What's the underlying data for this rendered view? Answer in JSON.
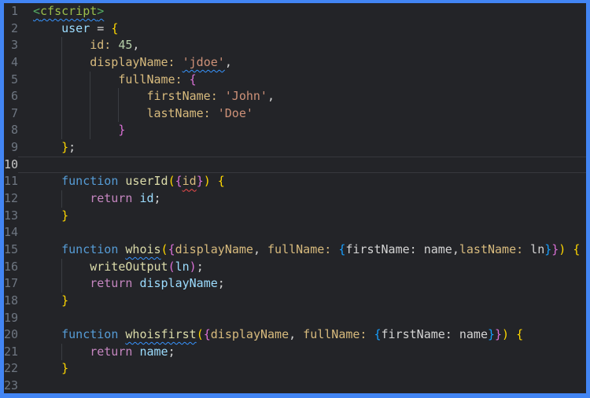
{
  "ui": {
    "frame_color": "#4285f4",
    "editor_background": "#232428",
    "gutter_color": "#6e7681",
    "active_gutter_color": "#c6c6c6",
    "indent_guide_color": "#3a3d42",
    "current_line_border_color": "#37383d"
  },
  "colors": {
    "tag": "#9cbe4a",
    "tagp": "#55ad63",
    "kw": "#569cd6",
    "ctrl": "#c586c0",
    "var": "#9cdcfe",
    "prop": "#d7ba7d",
    "str": "#ce9178",
    "num": "#b5cea8",
    "fn": "#dcdcaa",
    "pun": "#d4d4d4",
    "b1": "#ffd700",
    "b2": "#da70d6",
    "b3": "#179fff",
    "squiggle_info": "#3794ff",
    "squiggle_error": "#f14c4c"
  },
  "editor": {
    "current_line": "10",
    "lines": [
      {
        "num": "1",
        "indent": 0,
        "tokens": [
          {
            "t": "<",
            "c": "tagp",
            "u": "b"
          },
          {
            "t": "cfscript",
            "c": "tag",
            "u": "b"
          },
          {
            "t": ">",
            "c": "tagp",
            "u": "b"
          }
        ]
      },
      {
        "num": "2",
        "indent": 4,
        "tokens": [
          {
            "t": "user",
            "c": "var"
          },
          {
            "t": " = ",
            "c": "pun"
          },
          {
            "t": "{",
            "c": "b1"
          }
        ]
      },
      {
        "num": "3",
        "indent": 8,
        "tokens": [
          {
            "t": "id:",
            "c": "prop"
          },
          {
            "t": " ",
            "c": "pun"
          },
          {
            "t": "45",
            "c": "num"
          },
          {
            "t": ",",
            "c": "pun"
          }
        ]
      },
      {
        "num": "4",
        "indent": 8,
        "tokens": [
          {
            "t": "displayName:",
            "c": "prop"
          },
          {
            "t": " ",
            "c": "pun"
          },
          {
            "t": "'jdoe'",
            "c": "str",
            "u": "b"
          },
          {
            "t": ",",
            "c": "pun"
          }
        ]
      },
      {
        "num": "5",
        "indent": 12,
        "tokens": [
          {
            "t": "fullName:",
            "c": "prop"
          },
          {
            "t": " ",
            "c": "pun"
          },
          {
            "t": "{",
            "c": "b2"
          }
        ]
      },
      {
        "num": "6",
        "indent": 16,
        "tokens": [
          {
            "t": "firstName:",
            "c": "prop"
          },
          {
            "t": " ",
            "c": "pun"
          },
          {
            "t": "'John'",
            "c": "str"
          },
          {
            "t": ",",
            "c": "pun"
          }
        ]
      },
      {
        "num": "7",
        "indent": 16,
        "tokens": [
          {
            "t": "lastName:",
            "c": "prop"
          },
          {
            "t": " ",
            "c": "pun"
          },
          {
            "t": "'Doe'",
            "c": "str"
          }
        ]
      },
      {
        "num": "8",
        "indent": 12,
        "tokens": [
          {
            "t": "}",
            "c": "b2"
          }
        ]
      },
      {
        "num": "9",
        "indent": 4,
        "tokens": [
          {
            "t": "}",
            "c": "b1"
          },
          {
            "t": ";",
            "c": "pun"
          }
        ]
      },
      {
        "num": "10",
        "indent": 0,
        "current": true,
        "tokens": []
      },
      {
        "num": "11",
        "indent": 4,
        "tokens": [
          {
            "t": "function ",
            "c": "kw"
          },
          {
            "t": "userId",
            "c": "fn"
          },
          {
            "t": "(",
            "c": "b1"
          },
          {
            "t": "{",
            "c": "b2"
          },
          {
            "t": "id",
            "c": "prop",
            "u": "r"
          },
          {
            "t": "}",
            "c": "b2"
          },
          {
            "t": ")",
            "c": "b1"
          },
          {
            "t": " ",
            "c": "pun"
          },
          {
            "t": "{",
            "c": "b1"
          }
        ]
      },
      {
        "num": "12",
        "indent": 8,
        "tokens": [
          {
            "t": "return ",
            "c": "ctrl"
          },
          {
            "t": "id",
            "c": "var"
          },
          {
            "t": ";",
            "c": "pun"
          }
        ]
      },
      {
        "num": "13",
        "indent": 4,
        "tokens": [
          {
            "t": "}",
            "c": "b1"
          }
        ]
      },
      {
        "num": "14",
        "indent": 0,
        "tokens": []
      },
      {
        "num": "15",
        "indent": 4,
        "tokens": [
          {
            "t": "function ",
            "c": "kw"
          },
          {
            "t": "whois",
            "c": "fn",
            "u": "b"
          },
          {
            "t": "(",
            "c": "b1"
          },
          {
            "t": "{",
            "c": "b2"
          },
          {
            "t": "displayName",
            "c": "prop"
          },
          {
            "t": ", ",
            "c": "pun"
          },
          {
            "t": "fullName:",
            "c": "prop"
          },
          {
            "t": " ",
            "c": "pun"
          },
          {
            "t": "{",
            "c": "b3"
          },
          {
            "t": "firstName: name",
            "c": "pun"
          },
          {
            "t": ",",
            "c": "pun"
          },
          {
            "t": "lastName:",
            "c": "prop"
          },
          {
            "t": " ",
            "c": "pun"
          },
          {
            "t": "ln",
            "c": "pun"
          },
          {
            "t": "}",
            "c": "b3"
          },
          {
            "t": "}",
            "c": "b2"
          },
          {
            "t": ")",
            "c": "b1"
          },
          {
            "t": " ",
            "c": "pun"
          },
          {
            "t": "{",
            "c": "b1"
          }
        ]
      },
      {
        "num": "16",
        "indent": 8,
        "tokens": [
          {
            "t": "writeOutput",
            "c": "fn"
          },
          {
            "t": "(",
            "c": "b2"
          },
          {
            "t": "ln",
            "c": "var"
          },
          {
            "t": ")",
            "c": "b2"
          },
          {
            "t": ";",
            "c": "pun"
          }
        ]
      },
      {
        "num": "17",
        "indent": 8,
        "tokens": [
          {
            "t": "return ",
            "c": "ctrl"
          },
          {
            "t": "displayName",
            "c": "var"
          },
          {
            "t": ";",
            "c": "pun"
          }
        ]
      },
      {
        "num": "18",
        "indent": 4,
        "tokens": [
          {
            "t": "}",
            "c": "b1"
          }
        ]
      },
      {
        "num": "19",
        "indent": 0,
        "tokens": []
      },
      {
        "num": "20",
        "indent": 4,
        "tokens": [
          {
            "t": "function ",
            "c": "kw"
          },
          {
            "t": "whoisfirst",
            "c": "fn",
            "u": "b"
          },
          {
            "t": "(",
            "c": "b1"
          },
          {
            "t": "{",
            "c": "b2"
          },
          {
            "t": "displayName",
            "c": "prop"
          },
          {
            "t": ", ",
            "c": "pun"
          },
          {
            "t": "fullName:",
            "c": "prop"
          },
          {
            "t": " ",
            "c": "pun"
          },
          {
            "t": "{",
            "c": "b3"
          },
          {
            "t": "firstName: name",
            "c": "pun"
          },
          {
            "t": "}",
            "c": "b3"
          },
          {
            "t": "}",
            "c": "b2"
          },
          {
            "t": ")",
            "c": "b1"
          },
          {
            "t": " ",
            "c": "pun"
          },
          {
            "t": "{",
            "c": "b1"
          }
        ]
      },
      {
        "num": "21",
        "indent": 8,
        "tokens": [
          {
            "t": "return ",
            "c": "ctrl"
          },
          {
            "t": "name",
            "c": "var"
          },
          {
            "t": ";",
            "c": "pun"
          }
        ]
      },
      {
        "num": "22",
        "indent": 4,
        "tokens": [
          {
            "t": "}",
            "c": "b1"
          }
        ]
      },
      {
        "num": "23",
        "indent": 0,
        "tokens": []
      }
    ]
  }
}
